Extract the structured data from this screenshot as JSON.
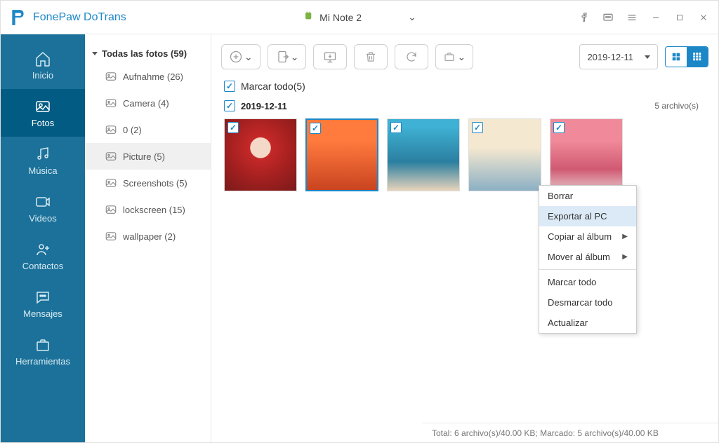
{
  "app": {
    "title": "FonePaw DoTrans"
  },
  "device": {
    "name": "Mi Note 2"
  },
  "nav": {
    "items": [
      {
        "label": "Inicio",
        "key": "home"
      },
      {
        "label": "Fotos",
        "key": "photos"
      },
      {
        "label": "Música",
        "key": "music"
      },
      {
        "label": "Videos",
        "key": "videos"
      },
      {
        "label": "Contactos",
        "key": "contacts"
      },
      {
        "label": "Mensajes",
        "key": "messages"
      },
      {
        "label": "Herramientas",
        "key": "tools"
      }
    ],
    "active": "photos"
  },
  "folders": {
    "header": "Todas las fotos (59)",
    "items": [
      {
        "label": "Aufnahme (26)"
      },
      {
        "label": "Camera (4)"
      },
      {
        "label": "0 (2)"
      },
      {
        "label": "Picture (5)",
        "active": true
      },
      {
        "label": "Screenshots (5)"
      },
      {
        "label": "lockscreen (15)"
      },
      {
        "label": "wallpaper (2)"
      }
    ]
  },
  "toolbar": {
    "date": "2019-12-11"
  },
  "content": {
    "selectAllLabel": "Marcar todo(5)",
    "group": {
      "date": "2019-12-11",
      "countLabel": "5 archivo(s)"
    }
  },
  "contextMenu": {
    "items": [
      {
        "label": "Borrar"
      },
      {
        "label": "Exportar al PC",
        "highlighted": true
      },
      {
        "label": "Copiar al álbum",
        "submenu": true
      },
      {
        "label": "Mover al álbum",
        "submenu": true
      },
      {
        "sep": true
      },
      {
        "label": "Marcar todo"
      },
      {
        "label": "Desmarcar todo"
      },
      {
        "label": "Actualizar"
      }
    ]
  },
  "status": {
    "text": "Total: 6 archivo(s)/40.00 KB; Marcado: 5 archivo(s)/40.00 KB"
  }
}
